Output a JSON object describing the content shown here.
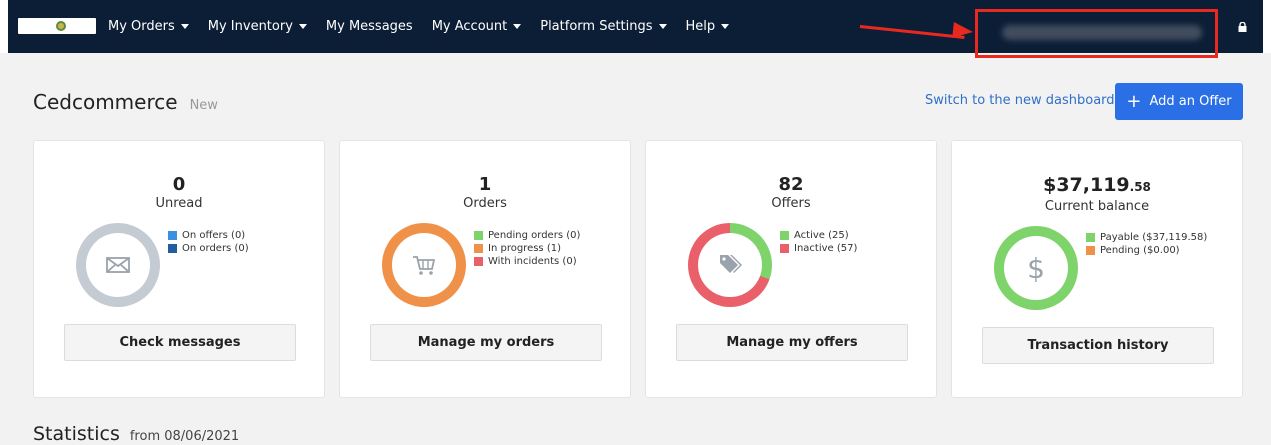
{
  "nav": {
    "items": [
      {
        "label": "My Orders",
        "dropdown": true
      },
      {
        "label": "My Inventory",
        "dropdown": true
      },
      {
        "label": "My Messages",
        "dropdown": false
      },
      {
        "label": "My Account",
        "dropdown": true
      },
      {
        "label": "Platform Settings",
        "dropdown": true
      },
      {
        "label": "Help",
        "dropdown": true
      }
    ],
    "account_name": "",
    "icons": {
      "logo": "marketplace-logo",
      "lock": "lock-icon"
    }
  },
  "header": {
    "title": "Cedcommerce",
    "badge": "New",
    "switch_link": "Switch to the new dashboard",
    "add_offer": "Add an Offer"
  },
  "cards": [
    {
      "value": "0",
      "label": "Unread",
      "icon": "envelope-icon",
      "legend": [
        {
          "text": "On offers (0)",
          "color": "#3a8fe0"
        },
        {
          "text": "On orders (0)",
          "color": "#1f5f9e"
        }
      ],
      "button": "Check messages"
    },
    {
      "value": "1",
      "label": "Orders",
      "icon": "cart-icon",
      "legend": [
        {
          "text": "Pending orders (0)",
          "color": "#7ed36b"
        },
        {
          "text": "In progress (1)",
          "color": "#f0914a"
        },
        {
          "text": "With incidents (0)",
          "color": "#e9606a"
        }
      ],
      "button": "Manage my orders"
    },
    {
      "value": "82",
      "label": "Offers",
      "icon": "tag-icon",
      "legend": [
        {
          "text": "Active (25)",
          "color": "#7ed36b"
        },
        {
          "text": "Inactive (57)",
          "color": "#e9606a"
        }
      ],
      "button": "Manage my offers"
    },
    {
      "value": "$37,119",
      "value_cents": ".58",
      "label": "Current balance",
      "icon": "dollar-icon",
      "legend": [
        {
          "text": "Payable ($37,119.58)",
          "color": "#7ed36b"
        },
        {
          "text": "Pending ($0.00)",
          "color": "#f0914a"
        }
      ],
      "button": "Transaction history"
    }
  ],
  "statistics": {
    "title": "Statistics",
    "date": "from 08/06/2021"
  },
  "colors": {
    "nav_bg": "#0c1e36",
    "accent": "#2a6fe6",
    "link": "#2f6fc9",
    "highlight": "#e8291f"
  }
}
